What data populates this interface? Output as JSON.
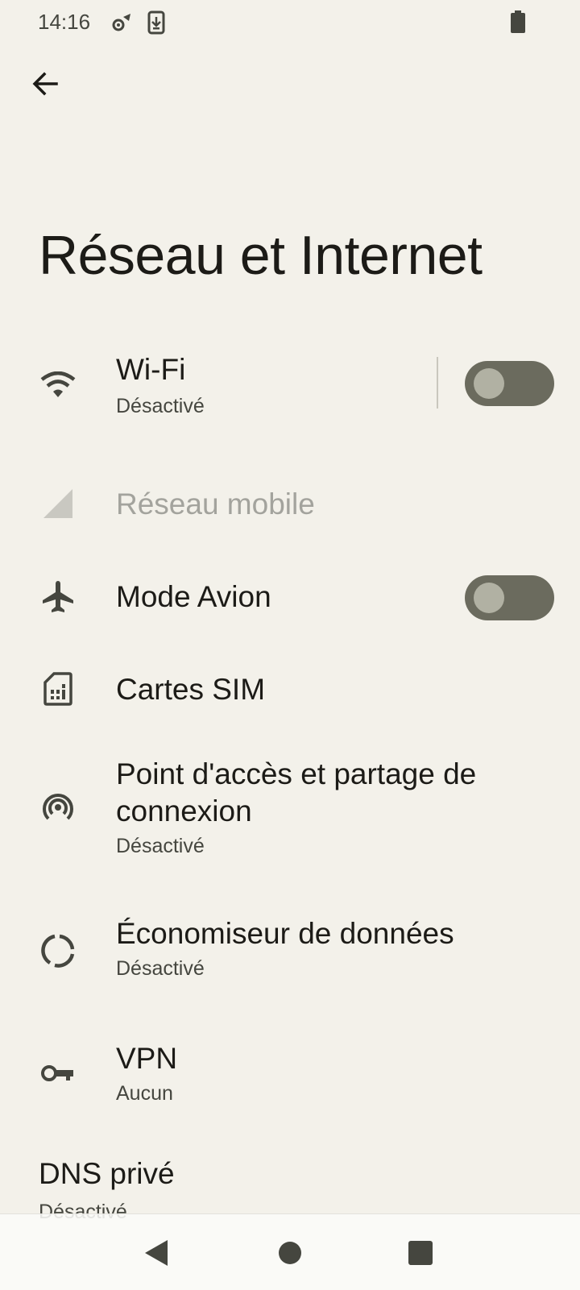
{
  "status_bar": {
    "time": "14:16",
    "icons": [
      "settings-notification-icon",
      "download-notification-icon",
      "battery-icon"
    ]
  },
  "header": {
    "back_icon": "arrow-left-icon",
    "title": "Réseau et Internet"
  },
  "items": [
    {
      "label": "Wi-Fi",
      "sub": "Désactivé",
      "icon": "wifi-icon",
      "toggle": false
    },
    {
      "label": "Réseau mobile",
      "icon": "cell-signal-icon",
      "disabled": true
    },
    {
      "label": "Mode Avion",
      "icon": "airplane-icon",
      "toggle": false
    },
    {
      "label": "Cartes SIM",
      "icon": "sim-card-icon"
    },
    {
      "label_line1": "Point d'accès et partage de",
      "label_line2": "connexion",
      "sub": "Désactivé",
      "icon": "hotspot-icon"
    },
    {
      "label": "Économiseur de données",
      "sub": "Désactivé",
      "icon": "data-saver-icon"
    },
    {
      "label": "VPN",
      "sub": "Aucun",
      "icon": "vpn-key-icon"
    },
    {
      "label": "DNS privé",
      "sub": "Désactivé"
    }
  ],
  "nav_bar": {
    "buttons": [
      "back-triangle-icon",
      "home-circle-icon",
      "recents-square-icon"
    ]
  },
  "colors": {
    "background": "#f3f1ea",
    "toggle_track_off": "#6b6b5e",
    "toggle_knob_off": "#b1b1a3",
    "text_primary": "#1c1b17",
    "text_secondary": "#45463f",
    "text_disabled": "#a3a39d"
  }
}
